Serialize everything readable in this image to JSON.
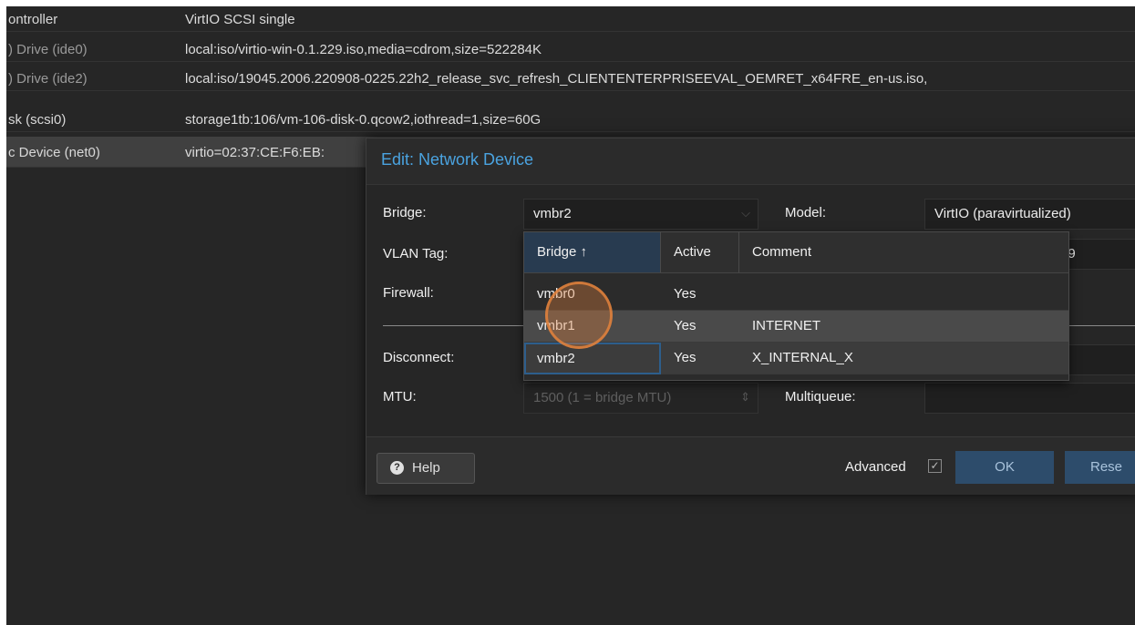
{
  "hardware": {
    "rows": [
      {
        "key": "ontroller",
        "value": "VirtIO SCSI single"
      },
      {
        "key": ") Drive (ide0)",
        "value": "local:iso/virtio-win-0.1.229.iso,media=cdrom,size=522284K"
      },
      {
        "key": ") Drive (ide2)",
        "value": "local:iso/19045.2006.220908-0225.22h2_release_svc_refresh_CLIENTENTERPRISEEVAL_OEMRET_x64FRE_en-us.iso,"
      },
      {
        "key": "sk (scsi0)",
        "value": "storage1tb:106/vm-106-disk-0.qcow2,iothread=1,size=60G"
      },
      {
        "key": "c Device (net0)",
        "value": "virtio=02:37:CE:F6:EB:"
      }
    ]
  },
  "dialog": {
    "title": "Edit: Network Device",
    "bridge_label": "Bridge:",
    "bridge_value": "vmbr2",
    "model_label": "Model:",
    "model_value": "VirtIO (paravirtualized)",
    "vlan_label": "VLAN Tag:",
    "mac_partial": "69",
    "firewall_label": "Firewall:",
    "disconnect_label": "Disconnect:",
    "mtu_label": "MTU:",
    "mtu_placeholder": "1500 (1 = bridge MTU)",
    "multiqueue_label": "Multiqueue:",
    "help_label": "Help",
    "advanced_label": "Advanced",
    "advanced_checked": true,
    "ok_label": "OK",
    "reset_label": "Rese"
  },
  "bridge_dropdown": {
    "columns": [
      "Bridge ↑",
      "Active",
      "Comment"
    ],
    "rows": [
      {
        "bridge": "vmbr0",
        "active": "Yes",
        "comment": ""
      },
      {
        "bridge": "vmbr1",
        "active": "Yes",
        "comment": "INTERNET"
      },
      {
        "bridge": "vmbr2",
        "active": "Yes",
        "comment": "X_INTERNAL_X"
      }
    ]
  },
  "colors": {
    "background": "#262626",
    "title_blue": "#4aa3e0",
    "button_blue": "#2d4c6b",
    "cursor_highlight": "#e2823c"
  }
}
